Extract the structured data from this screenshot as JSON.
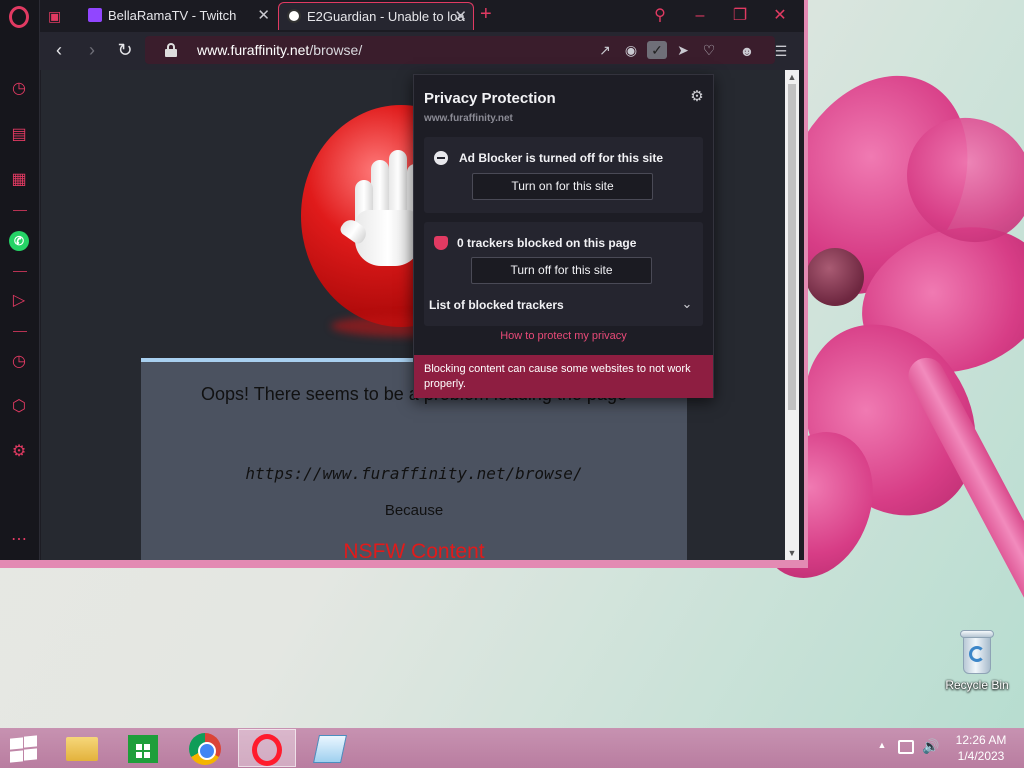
{
  "browser": {
    "tabs": [
      {
        "title": "BellaRamaTV - Twitch",
        "favicon": "twitch-icon"
      },
      {
        "title": "E2Guardian - Unable to loa",
        "favicon": "globe-icon",
        "active": true
      }
    ],
    "url": {
      "host": "www.furaffinity.net",
      "path": "/browse/"
    },
    "accent": "#e13a62"
  },
  "page": {
    "message_title": "Oops! There seems to be a problem loading the page",
    "blocked_url": "https://www.furaffinity.net/browse/",
    "because": "Because",
    "reason": "NSFW Content"
  },
  "privacy_popup": {
    "title": "Privacy Protection",
    "domain": "www.furaffinity.net",
    "ad_blocker": {
      "status": "Ad Blocker is turned off for this site",
      "button": "Turn on for this site"
    },
    "trackers": {
      "status": "0 trackers blocked on this page",
      "button": "Turn off for this site",
      "list_label": "List of blocked trackers"
    },
    "help_link": "How to protect my privacy",
    "warning": "Blocking content can cause some websites to not work properly."
  },
  "desktop": {
    "icons": [
      {
        "label": "Recycle Bin",
        "icon": "recycle-bin-icon"
      }
    ]
  },
  "taskbar": {
    "apps": [
      "file-explorer-icon",
      "store-icon",
      "chrome-icon",
      "opera-icon",
      "notes-icon"
    ],
    "clock": {
      "time": "12:26 AM",
      "date": "1/4/2023"
    }
  }
}
